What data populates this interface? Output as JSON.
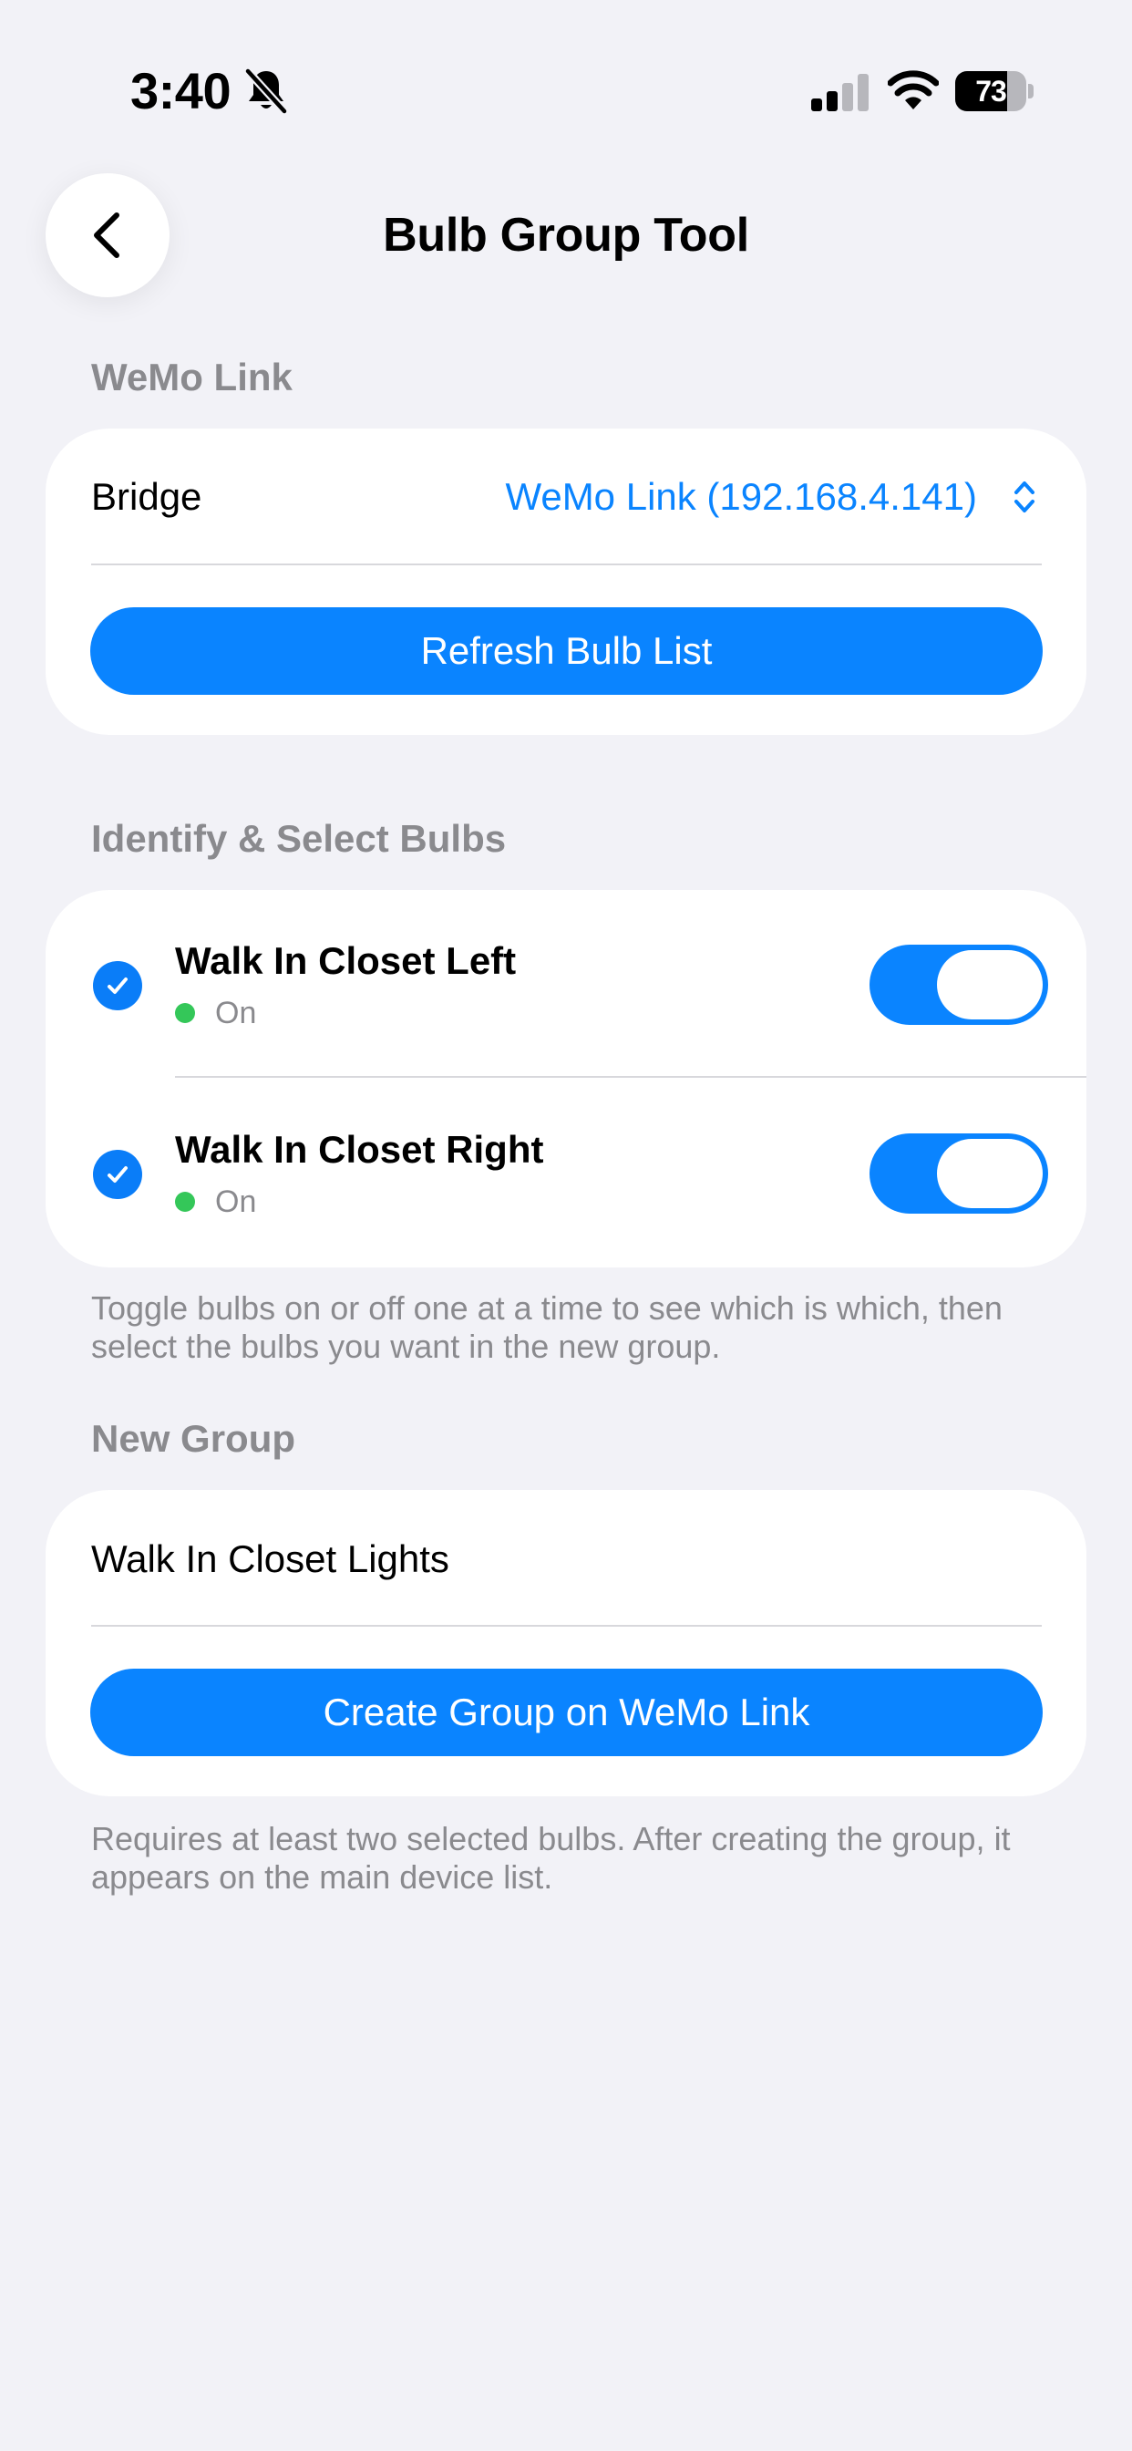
{
  "status_bar": {
    "time": "3:40",
    "battery_level": "73",
    "battery_fraction": 0.73,
    "icons": [
      "bell-slash-icon",
      "cellular-signal-icon",
      "wifi-icon",
      "battery-icon"
    ]
  },
  "nav": {
    "back_icon": "chevron-left-icon",
    "title": "Bulb Group Tool"
  },
  "wemo_link": {
    "header": "WeMo Link",
    "bridge_label": "Bridge",
    "bridge_value": "WeMo Link (192.168.4.141)",
    "bridge_icon": "chevron-up-down-icon",
    "refresh_label": "Refresh Bulb List"
  },
  "bulbs": {
    "header": "Identify & Select Bulbs",
    "items": [
      {
        "name": "Walk In Closet Left",
        "status": "On",
        "selected": true,
        "on": true
      },
      {
        "name": "Walk In Closet Right",
        "status": "On",
        "selected": true,
        "on": true
      }
    ],
    "footnote": "Toggle bulbs on or off one at a time to see which is which, then select the bulbs you want in the new group."
  },
  "new_group": {
    "header": "New Group",
    "name_value": "Walk In Closet Lights",
    "create_label": "Create Group on WeMo Link",
    "footnote": "Requires at least two selected bulbs. After creating the group, it appears on the main device list."
  },
  "colors": {
    "accent": "#0a84ff",
    "background": "#f2f2f7",
    "status_on": "#34c759",
    "secondary_text": "#8a8a8e"
  }
}
